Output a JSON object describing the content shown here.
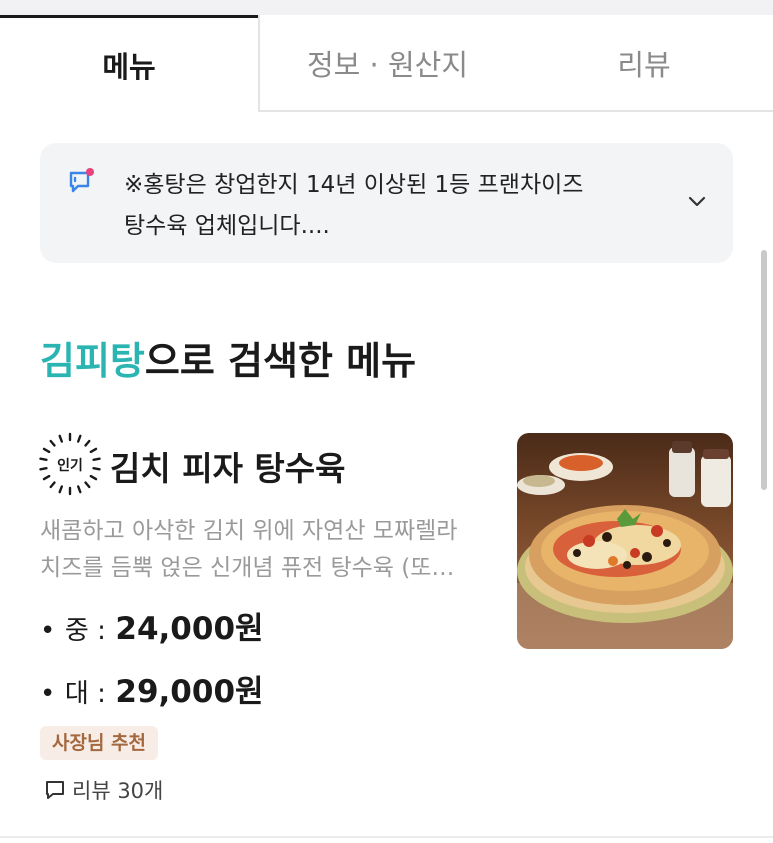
{
  "tabs": [
    {
      "label": "메뉴",
      "active": true
    },
    {
      "label": "정보 · 원산지",
      "active": false
    },
    {
      "label": "리뷰",
      "active": false
    }
  ],
  "notice": {
    "line1": "※홍탕은 창업한지 14년 이상된 1등 프랜차이즈",
    "line2": "탕수육 업체입니다....",
    "icon": "chat-notice-icon",
    "expand_icon": "chevron-down-icon"
  },
  "section": {
    "keyword": "김피탕",
    "title_suffix": "으로 검색한 메뉴",
    "keyword_color": "#2bb5b2"
  },
  "menu_item": {
    "badge": "인기",
    "name": "김치 피자 탕수육",
    "description_line1": "새콤하고 아삭한 김치 위에 자연산 모짜렐라",
    "description_line2": "치즈를 듬뿍 얹은 신개념 퓨전 탕수육 (또…",
    "prices": [
      {
        "bullet": "•",
        "size": "중 :",
        "amount": "24,000원"
      },
      {
        "bullet": "•",
        "size": "대 :",
        "amount": "29,000원"
      }
    ],
    "tag": "사장님 추천",
    "review_label": "리뷰 30개",
    "review_icon": "speech-bubble-icon",
    "image": "pizza-tangsuyuk-photo"
  },
  "colors": {
    "accent": "#2bb5b2",
    "tag_bg": "#f7ede6",
    "tag_text": "#a4683f",
    "notice_bg": "#f2f4f6"
  }
}
